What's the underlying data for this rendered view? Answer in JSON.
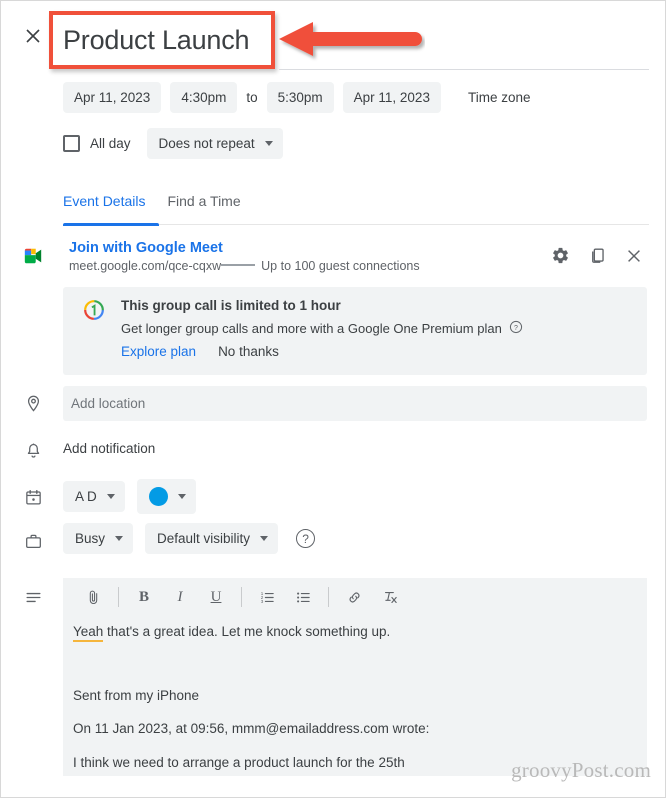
{
  "window": {
    "close_label": "✕"
  },
  "event": {
    "title": "Product Launch",
    "start_date": "Apr 11, 2023",
    "start_time": "4:30pm",
    "to_label": "to",
    "end_time": "5:30pm",
    "end_date": "Apr 11, 2023",
    "timezone_label": "Time zone",
    "all_day_label": "All day",
    "repeat_label": "Does not repeat"
  },
  "tabs": [
    {
      "label": "Event Details",
      "active": true
    },
    {
      "label": "Find a Time",
      "active": false
    }
  ],
  "meet": {
    "icon_name": "google-meet-icon",
    "join_label": "Join with Google Meet",
    "url": "meet.google.com/qce-cqxw",
    "guest_note": "Up to 100 guest connections",
    "settings_icon": "gear-icon",
    "copy_icon": "copy-icon",
    "close_icon": "close-icon"
  },
  "promo": {
    "badge_icon": "google-one-icon",
    "title": "This group call is limited to 1 hour",
    "subtitle": "Get longer group calls and more with a Google One Premium plan",
    "help_icon": "help-circle-icon",
    "explore_label": "Explore plan",
    "dismiss_label": "No thanks"
  },
  "location": {
    "icon": "location-pin-icon",
    "placeholder": "Add location",
    "value": ""
  },
  "notification": {
    "icon": "bell-icon",
    "label": "Add notification"
  },
  "calendar": {
    "icon": "calendar-icon",
    "owner_label": "A D",
    "color_hex": "#039be5"
  },
  "availability": {
    "icon": "briefcase-icon",
    "busy_label": "Busy",
    "visibility_label": "Default visibility",
    "help_icon": "help-circle-icon"
  },
  "description": {
    "icon": "description-lines-icon",
    "toolbar": [
      {
        "name": "attach-icon",
        "label": ""
      },
      {
        "name": "bold-icon",
        "label": "B"
      },
      {
        "name": "italic-icon",
        "label": "I"
      },
      {
        "name": "underline-icon",
        "label": "U"
      },
      {
        "name": "numbered-list-icon",
        "label": ""
      },
      {
        "name": "bulleted-list-icon",
        "label": ""
      },
      {
        "name": "link-icon",
        "label": ""
      },
      {
        "name": "remove-formatting-icon",
        "label": ""
      }
    ],
    "line1_misspelled": "Yeah",
    "line1_rest": " that's a great idea. Let me knock something up.",
    "line2": "Sent from my iPhone",
    "line3": "On 11 Jan 2023, at 09:56, mmm@emailaddress.com wrote:",
    "line4": "I think we need to arrange a product launch for the 25th"
  },
  "annotation": {
    "arrow_color": "#f0503a",
    "highlight_color": "#f0503a"
  },
  "watermark": "groovyPost.com"
}
